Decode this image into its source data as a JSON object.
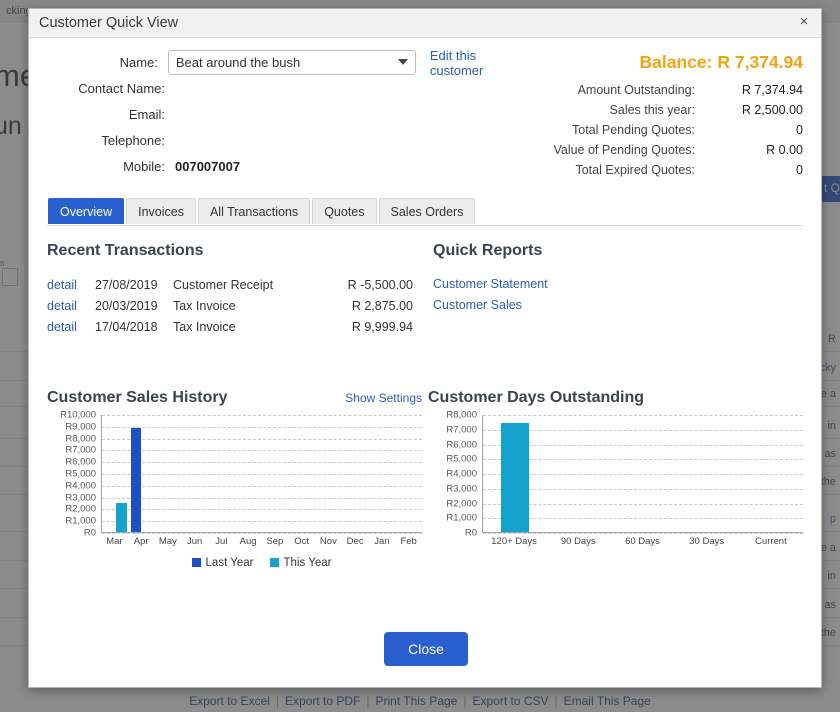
{
  "background": {
    "topbar_text": "cking",
    "heading1": "me",
    "heading2": "un A",
    "small_text": "s",
    "blue_button": "t Q",
    "rows": [
      {
        "text": "R"
      },
      {
        "text": "cky"
      },
      {
        "text": "ance a"
      },
      {
        "text": "in"
      },
      {
        "text": "nce as"
      },
      {
        "text": "or the"
      },
      {
        "text": "p"
      },
      {
        "text": "ance a"
      },
      {
        "text": "in"
      },
      {
        "text": "nce as"
      },
      {
        "text": "or the"
      }
    ],
    "footer_links": [
      "Export to Excel",
      "Export to PDF",
      "Print This Page",
      "Export to CSV",
      "Email This Page"
    ],
    "footer_separator": "|"
  },
  "modal": {
    "title": "Customer Quick View",
    "close_icon": "close-icon",
    "close_glyph": "×"
  },
  "customer": {
    "fields": [
      {
        "label": "Name:",
        "value": "Beat around the bush",
        "type": "select"
      },
      {
        "label": "Contact Name:",
        "value": "",
        "type": "text"
      },
      {
        "label": "Email:",
        "value": "",
        "type": "text"
      },
      {
        "label": "Telephone:",
        "value": "",
        "type": "text"
      },
      {
        "label": "Mobile:",
        "value": "007007007",
        "type": "text"
      }
    ],
    "edit_link": "Edit this customer"
  },
  "summary": {
    "balance_label": "Balance:",
    "balance_value": "R 7,374.94",
    "balance_color": "#f2a312",
    "rows": [
      {
        "label": "Amount Outstanding:",
        "value": "R 7,374.94"
      },
      {
        "label": "Sales this year:",
        "value": "R 2,500.00"
      },
      {
        "label": "Total Pending Quotes:",
        "value": "0"
      },
      {
        "label": "Value of Pending Quotes:",
        "value": "R 0.00"
      },
      {
        "label": "Total Expired Quotes:",
        "value": "0"
      }
    ]
  },
  "tabs": [
    {
      "label": "Overview",
      "active": true
    },
    {
      "label": "Invoices",
      "active": false
    },
    {
      "label": "All Transactions",
      "active": false
    },
    {
      "label": "Quotes",
      "active": false
    },
    {
      "label": "Sales Orders",
      "active": false
    }
  ],
  "recent_transactions": {
    "title": "Recent Transactions",
    "detail_label": "detail",
    "rows": [
      {
        "detail": "detail",
        "date": "27/08/2019",
        "type": "Customer Receipt",
        "amount": "R -5,500.00"
      },
      {
        "detail": "detail",
        "date": "20/03/2019",
        "type": "Tax Invoice",
        "amount": "R 2,875.00"
      },
      {
        "detail": "detail",
        "date": "17/04/2018",
        "type": "Tax Invoice",
        "amount": "R 9,999.94"
      }
    ]
  },
  "quick_reports": {
    "title": "Quick Reports",
    "links": [
      "Customer Statement",
      "Customer Sales"
    ]
  },
  "sales_chart_settings_link": "Show Settings",
  "footer": {
    "close_button": "Close"
  },
  "chart_data": [
    {
      "type": "bar",
      "title": "Customer Sales History",
      "xlabel": "",
      "ylabel": "",
      "ylim": [
        0,
        10000
      ],
      "yticks": [
        0,
        1000,
        2000,
        3000,
        4000,
        5000,
        6000,
        7000,
        8000,
        9000,
        10000
      ],
      "ytick_labels": [
        "R0",
        "R1,000",
        "R2,000",
        "R3,000",
        "R4,000",
        "R5,000",
        "R6,000",
        "R7,000",
        "R8,000",
        "R9,000",
        "R10,000"
      ],
      "categories": [
        "Mar",
        "Apr",
        "May",
        "Jun",
        "Jul",
        "Aug",
        "Sep",
        "Oct",
        "Nov",
        "Dec",
        "Jan",
        "Feb"
      ],
      "grid": true,
      "legend_position": "bottom",
      "series": [
        {
          "name": "Last Year",
          "color": "#1f4fc4",
          "values": [
            0,
            8800,
            0,
            0,
            0,
            0,
            0,
            0,
            0,
            0,
            0,
            0
          ]
        },
        {
          "name": "This Year",
          "color": "#14a3ce",
          "values": [
            2500,
            0,
            0,
            0,
            0,
            0,
            0,
            0,
            0,
            0,
            0,
            0
          ]
        }
      ]
    },
    {
      "type": "bar",
      "title": "Customer Days Outstanding",
      "xlabel": "",
      "ylabel": "",
      "ylim": [
        0,
        8000
      ],
      "yticks": [
        0,
        1000,
        2000,
        3000,
        4000,
        5000,
        6000,
        7000,
        8000
      ],
      "ytick_labels": [
        "R0",
        "R1,000",
        "R2,000",
        "R3,000",
        "R4,000",
        "R5,000",
        "R6,000",
        "R7,000",
        "R8,000"
      ],
      "categories": [
        "120+ Days",
        "90 Days",
        "60 Days",
        "30 Days",
        "Current"
      ],
      "grid": true,
      "legend_position": "none",
      "series": [
        {
          "name": "Outstanding",
          "color": "#14a3ce",
          "values": [
            7374.94,
            0,
            0,
            0,
            0
          ]
        }
      ]
    }
  ]
}
